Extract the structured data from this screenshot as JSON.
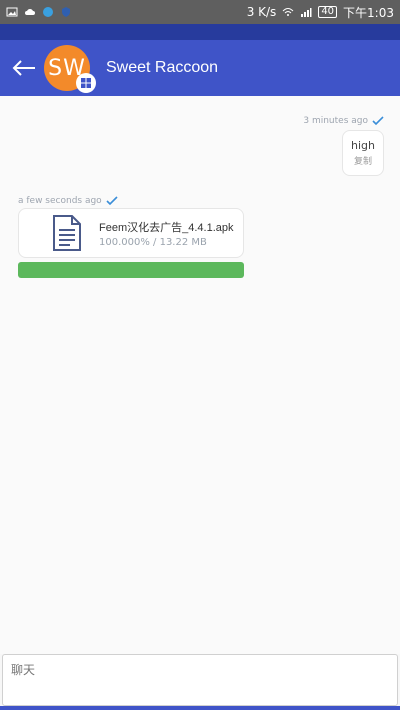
{
  "status_bar": {
    "speed": "3 K/s",
    "battery": "40",
    "time": "下午1:03"
  },
  "app_bar": {
    "avatar_initials": "SW",
    "contact_name": "Sweet Raccoon"
  },
  "messages": {
    "right": {
      "time": "3 minutes ago",
      "text": "high",
      "action": "复制"
    },
    "file": {
      "time": "a few seconds ago",
      "name": "Feem汉化去广告_4.4.1.apk",
      "progress_text": "100.000% / 13.22 MB",
      "progress": 1.0
    }
  },
  "input": {
    "placeholder": "聊天"
  },
  "colors": {
    "appbar": "#3f54c8",
    "avatar": "#f38a2a",
    "progress": "#5cb85c",
    "check": "#3a8ed8"
  }
}
